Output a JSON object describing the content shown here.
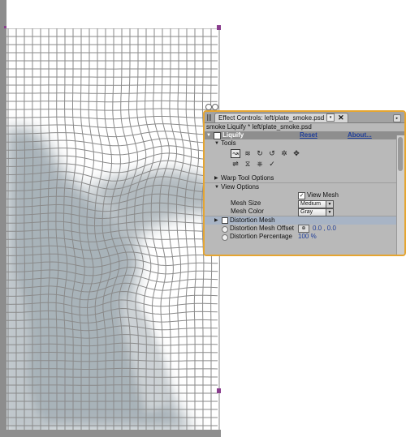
{
  "panel": {
    "tab_label": "Effect Controls: left/plate_smoke.psd",
    "tab_dropdown_glyph": "▾",
    "tab_close_glyph": "✕",
    "breadcrumb": "smoke Liquify * left/plate_smoke.psd",
    "effect": {
      "name": "Liquify",
      "reset_label": "Reset",
      "about_label": "About..."
    },
    "sections": {
      "tools_label": "Tools",
      "warp_tool_options_label": "Warp Tool Options",
      "view_options_label": "View Options"
    },
    "tools": [
      {
        "icon": "warp-tool-icon",
        "glyph": "↝",
        "active": true
      },
      {
        "icon": "turbulence-tool-icon",
        "glyph": "≋"
      },
      {
        "icon": "twirl-clockwise-icon",
        "glyph": "↻"
      },
      {
        "icon": "twirl-counterclockwise-icon",
        "glyph": "↺"
      },
      {
        "icon": "pucker-tool-icon",
        "glyph": "✲"
      },
      {
        "icon": "bloat-tool-icon",
        "glyph": "✥"
      },
      {
        "icon": "shift-pixels-icon",
        "glyph": "⇌"
      },
      {
        "icon": "reflection-tool-icon",
        "glyph": "⧖"
      },
      {
        "icon": "clone-tool-icon",
        "glyph": "⎈"
      },
      {
        "icon": "reconstruction-tool-icon",
        "glyph": "✓"
      }
    ],
    "view_options": {
      "view_mesh_label": "View Mesh",
      "view_mesh_checked": true,
      "mesh_size_label": "Mesh Size",
      "mesh_size_value": "Medium",
      "mesh_color_label": "Mesh Color",
      "mesh_color_value": "Gray"
    },
    "distortion_mesh_label": "Distortion Mesh",
    "distortion_mesh_offset_label": "Distortion Mesh Offset",
    "distortion_mesh_offset_value": "0.0 , 0.0",
    "distortion_percentage_label": "Distortion Percentage",
    "distortion_percentage_value": "100 %"
  },
  "colors": {
    "panel_border": "#e5a531",
    "value_blue": "#1f3e9a",
    "mesh_line": "#8a8a8a",
    "smoke": "#9aa6ad",
    "handle": "#8a3e8e"
  }
}
